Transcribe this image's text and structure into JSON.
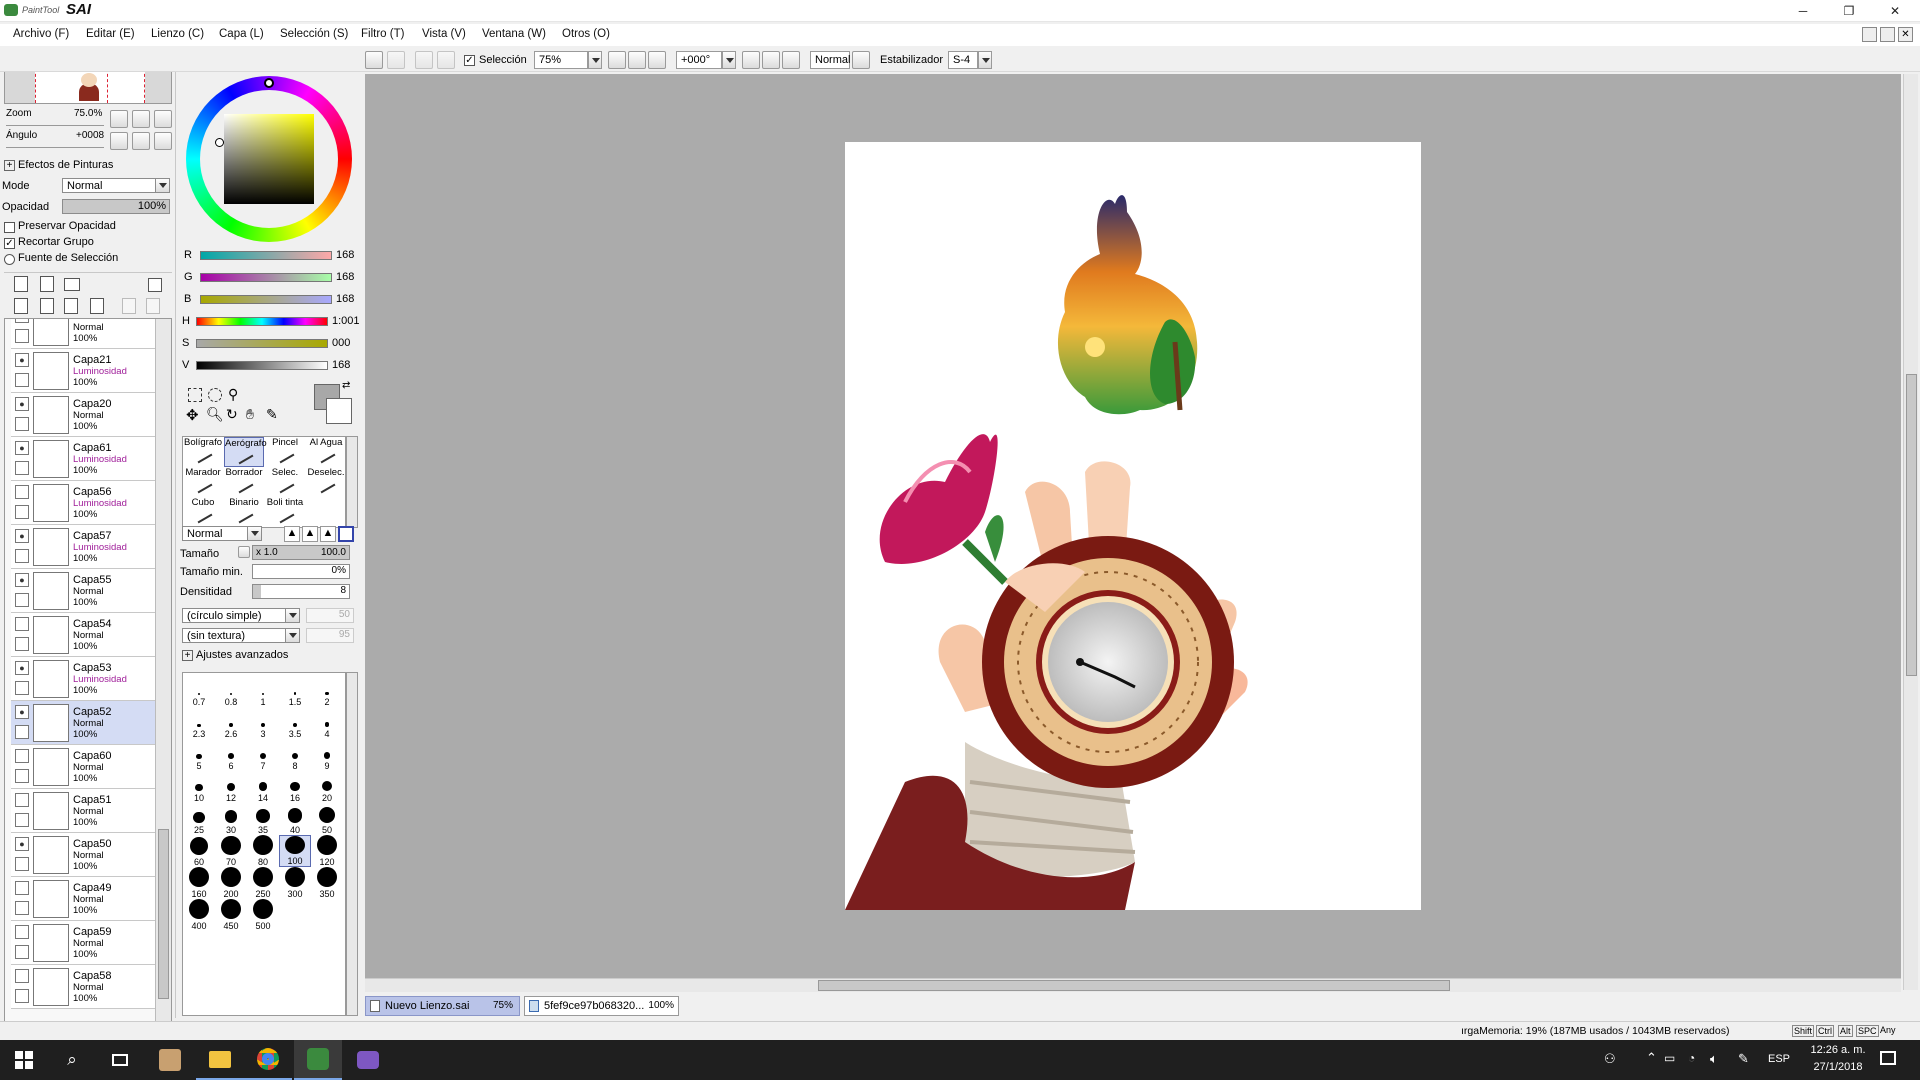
{
  "app": {
    "title_small": "PaintTool",
    "title_big": "SAI"
  },
  "window": {
    "minimize": "─",
    "restore": "❐",
    "close": "✕"
  },
  "menu": [
    "Archivo (F)",
    "Editar (E)",
    "Lienzo (C)",
    "Capa (L)",
    "Selección (S)",
    "Filtro (T)",
    "Vista (V)",
    "Ventana (W)",
    "Otros (O)"
  ],
  "toolbar": {
    "selection_label": "Selección",
    "selection_checked": true,
    "zoom_value": "75%",
    "angle_value": "+000°",
    "blend_value": "Normal",
    "stabilizer_label": "Estabilizador",
    "stabilizer_value": "S-4"
  },
  "navigator": {
    "zoom_label": "Zoom",
    "zoom_value": "75.0%",
    "angle_label": "Ángulo",
    "angle_value": "+0008"
  },
  "effects": {
    "header": "Efectos de Pinturas",
    "mode_label": "Mode",
    "mode_value": "Normal",
    "opacity_label": "Opacidad",
    "opacity_value": "100%",
    "preserve_opacity": "Preservar Opacidad",
    "clip_group": "Recortar Grupo",
    "selection_source": "Fuente de Selección"
  },
  "layers": [
    {
      "name": "",
      "mode": "Normal",
      "opacity": "100%",
      "visible": false,
      "mode_color": "#000"
    },
    {
      "name": "Capa21",
      "mode": "Luminosidad",
      "opacity": "100%",
      "visible": true,
      "mode_color": "#a0209a"
    },
    {
      "name": "Capa20",
      "mode": "Normal",
      "opacity": "100%",
      "visible": true,
      "mode_color": "#000"
    },
    {
      "name": "Capa61",
      "mode": "Luminosidad",
      "opacity": "100%",
      "visible": true,
      "mode_color": "#a0209a"
    },
    {
      "name": "Capa56",
      "mode": "Luminosidad",
      "opacity": "100%",
      "visible": false,
      "mode_color": "#a0209a"
    },
    {
      "name": "Capa57",
      "mode": "Luminosidad",
      "opacity": "100%",
      "visible": true,
      "mode_color": "#a0209a"
    },
    {
      "name": "Capa55",
      "mode": "Normal",
      "opacity": "100%",
      "visible": true,
      "mode_color": "#000"
    },
    {
      "name": "Capa54",
      "mode": "Normal",
      "opacity": "100%",
      "visible": false,
      "mode_color": "#000"
    },
    {
      "name": "Capa53",
      "mode": "Luminosidad",
      "opacity": "100%",
      "visible": true,
      "mode_color": "#a0209a"
    },
    {
      "name": "Capa52",
      "mode": "Normal",
      "opacity": "100%",
      "visible": true,
      "mode_color": "#000"
    },
    {
      "name": "Capa60",
      "mode": "Normal",
      "opacity": "100%",
      "visible": false,
      "mode_color": "#000"
    },
    {
      "name": "Capa51",
      "mode": "Normal",
      "opacity": "100%",
      "visible": false,
      "mode_color": "#000"
    },
    {
      "name": "Capa50",
      "mode": "Normal",
      "opacity": "100%",
      "visible": true,
      "mode_color": "#000"
    },
    {
      "name": "Capa49",
      "mode": "Normal",
      "opacity": "100%",
      "visible": false,
      "mode_color": "#000"
    },
    {
      "name": "Capa59",
      "mode": "Normal",
      "opacity": "100%",
      "visible": false,
      "mode_color": "#000"
    },
    {
      "name": "Capa58",
      "mode": "Normal",
      "opacity": "100%",
      "visible": false,
      "mode_color": "#000"
    }
  ],
  "color": {
    "r_label": "R",
    "r_value": "168",
    "g_label": "G",
    "g_value": "168",
    "b_label": "B",
    "b_value": "168",
    "h_label": "H",
    "h_value": "1:001",
    "s_label": "S",
    "s_value": "000",
    "v_label": "V",
    "v_value": "168",
    "current": "#a8a8a8"
  },
  "tools": [
    {
      "label": "Bolígrafo",
      "selected": false
    },
    {
      "label": "Aerógrafo",
      "selected": true
    },
    {
      "label": "Pincel",
      "selected": false
    },
    {
      "label": "Al Agua",
      "selected": false
    },
    {
      "label": "Marador",
      "selected": false
    },
    {
      "label": "Borrador",
      "selected": false
    },
    {
      "label": "Selec.",
      "selected": false
    },
    {
      "label": "Deselec.",
      "selected": false
    },
    {
      "label": "Cubo",
      "selected": false
    },
    {
      "label": "Binario",
      "selected": false
    },
    {
      "label": "Boli tinta",
      "selected": false
    }
  ],
  "brush": {
    "blend": "Normal",
    "size_label": "Tamaño",
    "size_mult": "x 1.0",
    "size_value": "100.0",
    "min_size_label": "Tamaño min.",
    "min_size_value": "0%",
    "density_label": "Densitidad",
    "density_value": "8",
    "shape": "(círculo simple)",
    "shape_value": "50",
    "texture": "(sin textura)",
    "texture_value": "95",
    "advanced": "Ajustes avanzados",
    "sizes": [
      "0.7",
      "0.8",
      "1",
      "1.5",
      "2",
      "2.3",
      "2.6",
      "3",
      "3.5",
      "4",
      "5",
      "6",
      "7",
      "8",
      "9",
      "10",
      "12",
      "14",
      "16",
      "20",
      "25",
      "30",
      "35",
      "40",
      "50",
      "60",
      "70",
      "80",
      "100",
      "120",
      "160",
      "200",
      "250",
      "300",
      "350",
      "400",
      "450",
      "500"
    ],
    "selected_size": "100"
  },
  "tabs": [
    {
      "name": "Nuevo Lienzo.sai",
      "zoom": "75%"
    },
    {
      "name": "5fef9ce97b068320...",
      "zoom": "100%"
    }
  ],
  "status": {
    "memory": "ırgaMemoria: 19% (187MB usados / 1043MB reservados)",
    "keys": [
      "Shift",
      "Ctrl",
      "Alt",
      "SPC"
    ],
    "any": "Any"
  },
  "taskbar": {
    "lang": "ESP",
    "time": "12:26 a. m.",
    "date": "27/1/2018"
  }
}
